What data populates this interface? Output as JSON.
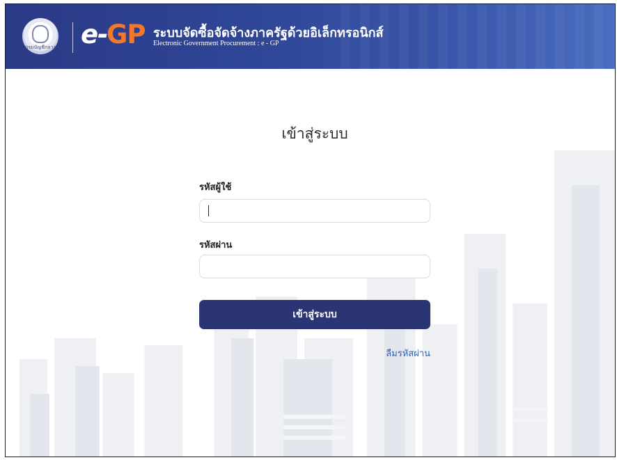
{
  "header": {
    "seal_text": "กรมบัญชีกลาง",
    "logo_e": "e-",
    "logo_gp": "GP",
    "title": "ระบบจัดซื้อจัดจ้างภาครัฐด้วยอิเล็กทรอนิกส์",
    "subtitle": "Electronic Government Procurement : e - GP"
  },
  "login": {
    "title": "เข้าสู่ระบบ",
    "username_label": "รหัสผู้ใช้",
    "username_value": "",
    "password_label": "รหัสผ่าน",
    "password_value": "",
    "submit_label": "เข้าสู่ระบบ",
    "forgot_label": "ลืมรหัสผ่าน"
  },
  "colors": {
    "header_bg": "#2f4596",
    "logo_accent": "#f5772a",
    "button_bg": "#2b3574",
    "link": "#2a64b8"
  }
}
